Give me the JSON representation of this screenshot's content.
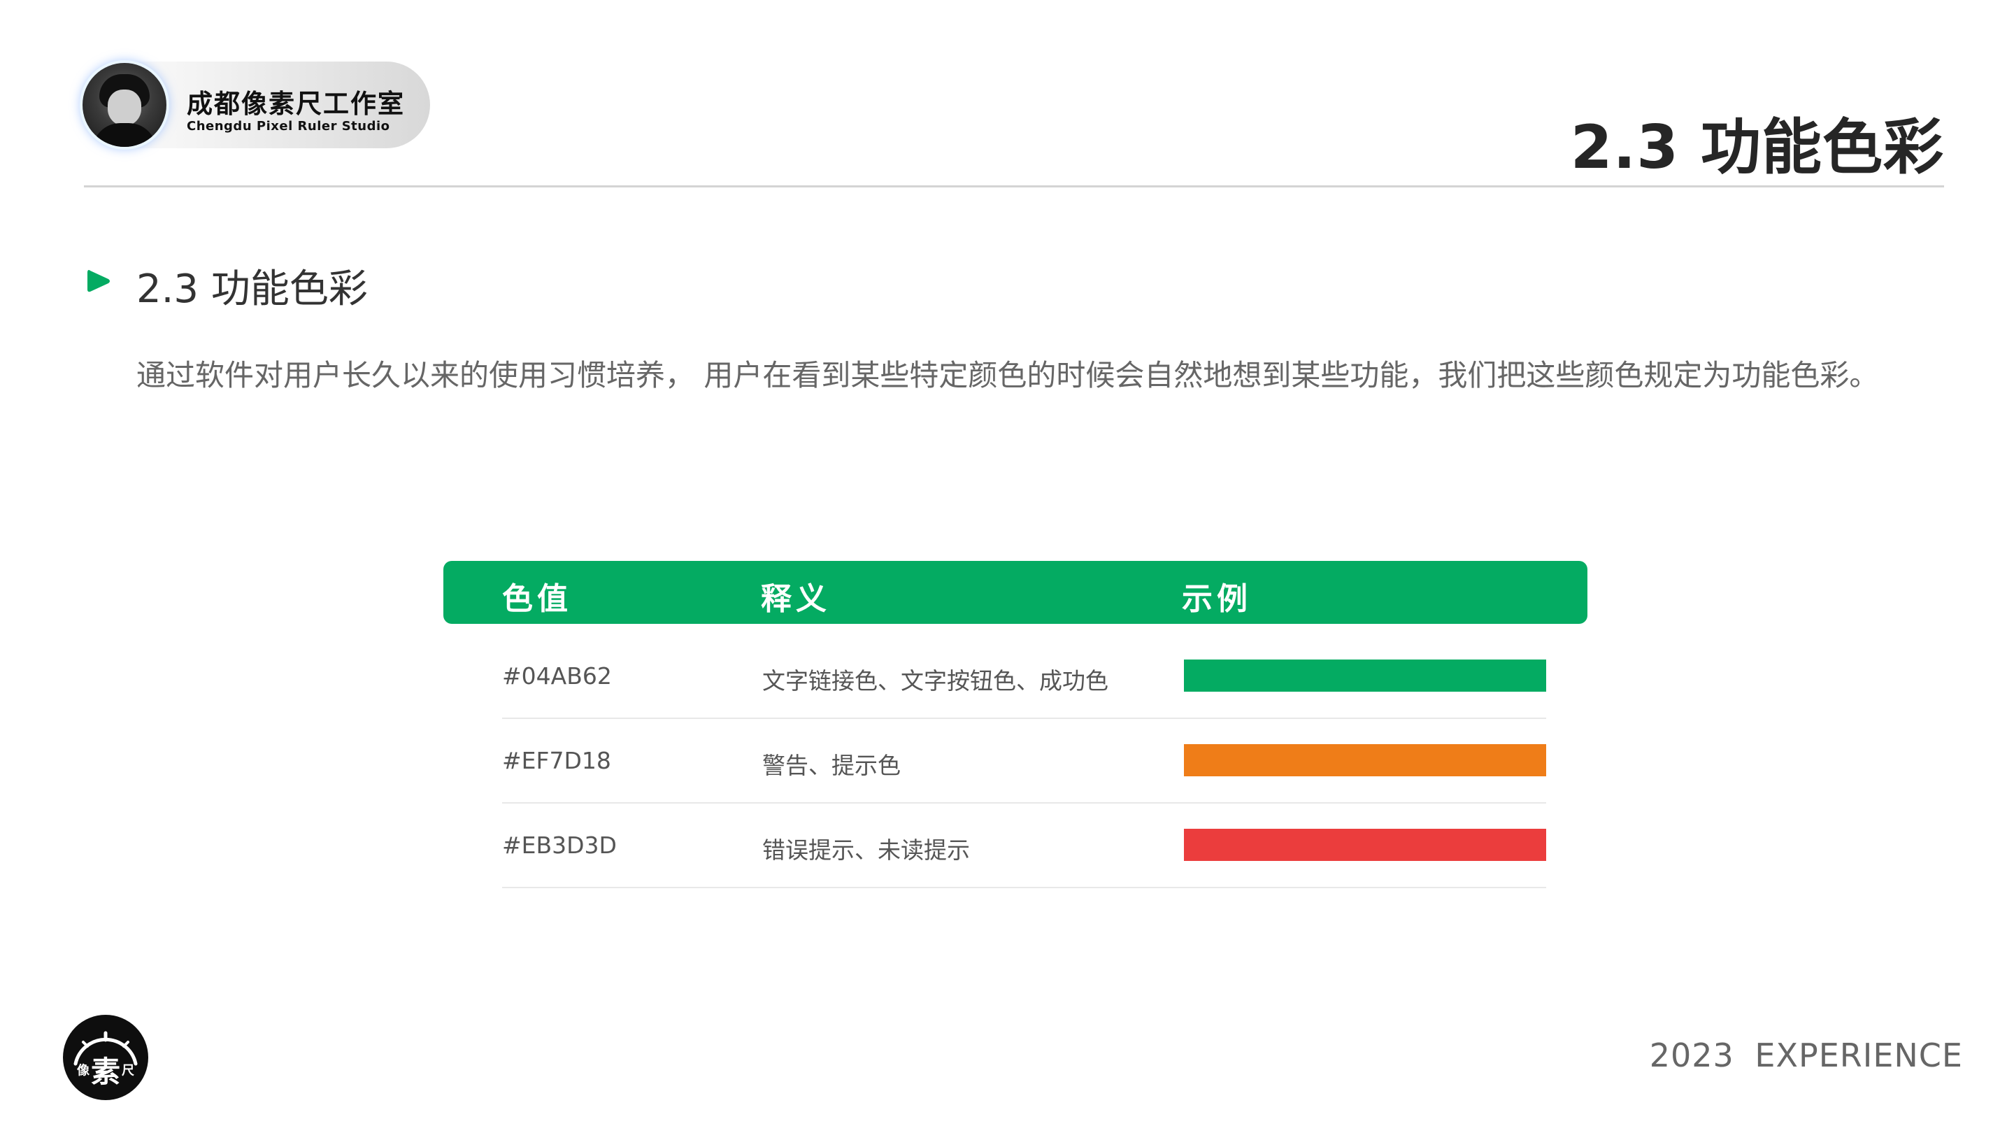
{
  "header": {
    "avatar_alt": "avatar",
    "studio_name_cn": "成都像素尺工作室",
    "studio_name_en": "Chengdu Pixel Ruler Studio",
    "page_heading": "2.3 功能色彩"
  },
  "section": {
    "bullet_icon": "play-icon",
    "accent_color": "#04AB62",
    "title": "2.3 功能色彩",
    "intro": "通过软件对用户长久以来的使用习惯培养， 用户在看到某些特定颜色的时候会自然地想到某些功能，我们把这些颜色规定为功能色彩。"
  },
  "table": {
    "header_color": "#04AB62",
    "columns": [
      "色值",
      "释义",
      "示例"
    ],
    "rows": [
      {
        "code": "#04AB62",
        "meaning": "文字链接色、文字按钮色、成功色",
        "swatch": "#04AB62"
      },
      {
        "code": "#EF7D18",
        "meaning": "警告、提示色",
        "swatch": "#EF7D18"
      },
      {
        "code": "#EB3D3D",
        "meaning": "错误提示、未读提示",
        "swatch": "#EB3D3D"
      }
    ]
  },
  "footer": {
    "logo_small_left": "像",
    "logo_main": "素",
    "logo_small_right": "尺",
    "text": "2023 EXPERIENCE"
  }
}
